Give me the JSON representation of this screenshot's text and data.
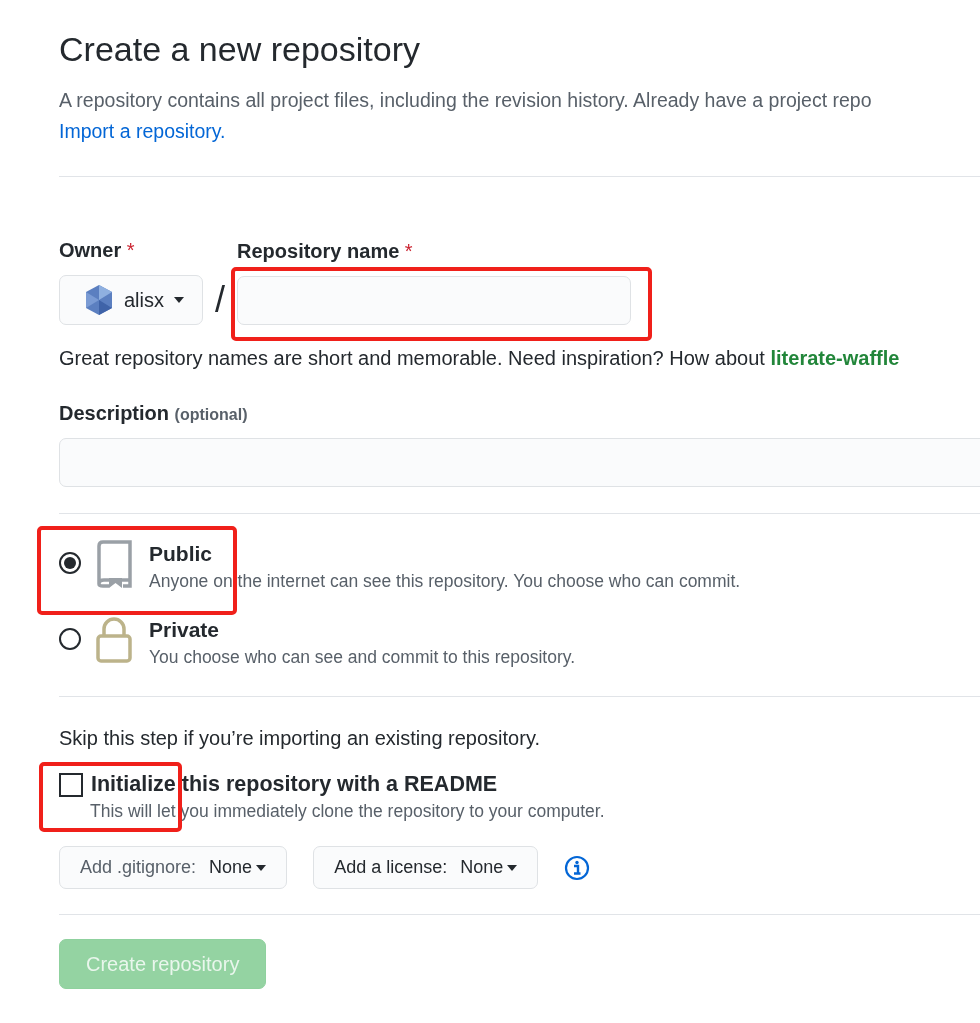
{
  "title": "Create a new repository",
  "intro": "A repository contains all project files, including the revision history. Already have a project repo",
  "import_link": "Import a repository.",
  "owner": {
    "label": "Owner",
    "required_mark": "*",
    "value": "alisx"
  },
  "separator": "/",
  "repo_name": {
    "label": "Repository name",
    "required_mark": "*",
    "highlighted": true
  },
  "hint": {
    "text": "Great repository names are short and memorable. Need inspiration? How about",
    "suggestion": "literate-waffle"
  },
  "description": {
    "label": "Description",
    "optional": "(optional)"
  },
  "visibility": [
    {
      "kind": "public",
      "title": "Public",
      "desc": "Anyone on the internet can see this repository. You choose who can commit.",
      "selected": true,
      "highlighted": true
    },
    {
      "kind": "private",
      "title": "Private",
      "desc": "You choose who can see and commit to this repository.",
      "selected": false
    }
  ],
  "skip_text": "Skip this step if you’re importing an existing repository.",
  "readme": {
    "label": "Initialize this repository with a README",
    "desc": "This will let you immediately clone the repository to your computer.",
    "checked": false,
    "highlighted": true
  },
  "dropdowns": [
    {
      "label": "Add .gitignore:",
      "value": "None"
    },
    {
      "label": "Add a license:",
      "value": "None"
    }
  ],
  "create_button": {
    "label": "Create repository",
    "disabled": true
  }
}
